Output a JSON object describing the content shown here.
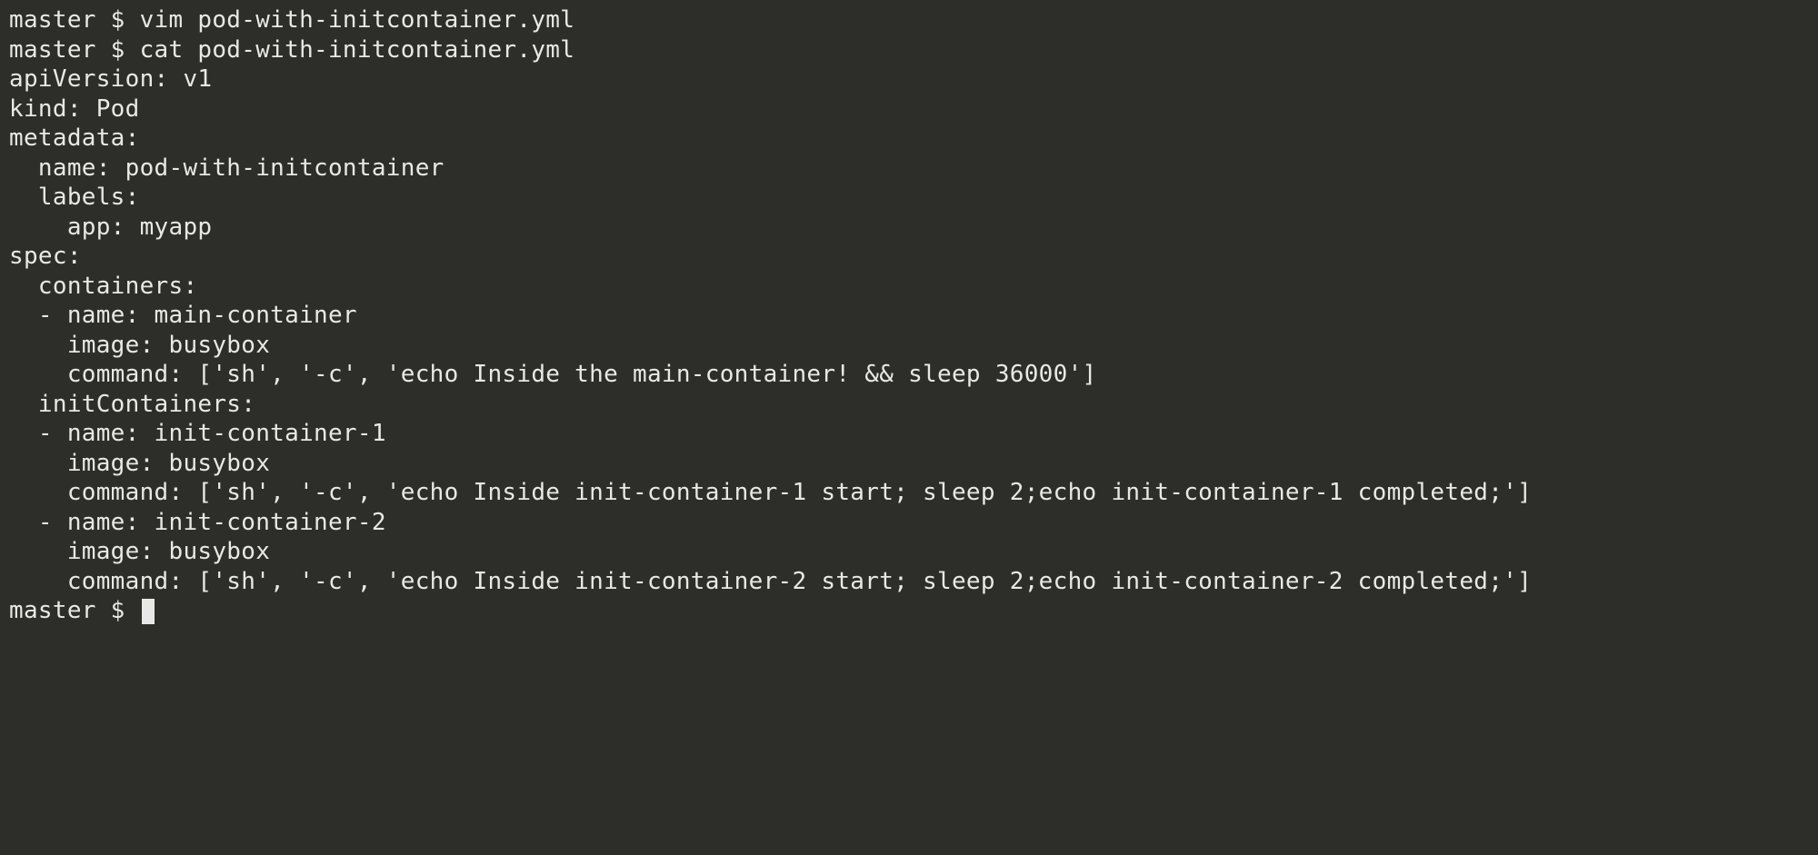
{
  "lines": {
    "l0": "master $ vim pod-with-initcontainer.yml",
    "l1": "master $ cat pod-with-initcontainer.yml",
    "l2": "apiVersion: v1",
    "l3": "kind: Pod",
    "l4": "metadata:",
    "l5": "  name: pod-with-initcontainer",
    "l6": "  labels:",
    "l7": "    app: myapp",
    "l8": "spec:",
    "l9": "  containers:",
    "l10": "  - name: main-container",
    "l11": "    image: busybox",
    "l12": "    command: ['sh', '-c', 'echo Inside the main-container! && sleep 36000']",
    "l13": "  initContainers:",
    "l14": "  - name: init-container-1",
    "l15": "    image: busybox",
    "l16": "    command: ['sh', '-c', 'echo Inside init-container-1 start; sleep 2;echo init-container-1 completed;']",
    "l17": "  - name: init-container-2",
    "l18": "    image: busybox",
    "l19": "    command: ['sh', '-c', 'echo Inside init-container-2 start; sleep 2;echo init-container-2 completed;']",
    "l20": "master $ "
  }
}
